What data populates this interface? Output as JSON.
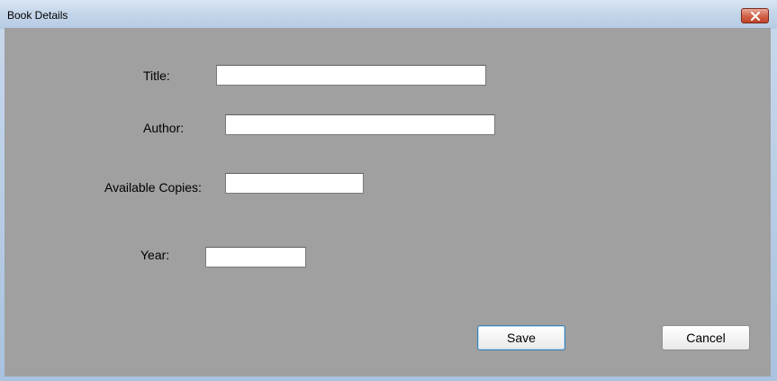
{
  "window": {
    "title": "Book Details",
    "close_icon": "close-icon"
  },
  "form": {
    "title_label": "Title:",
    "title_value": "",
    "author_label": "Author:",
    "author_value": "",
    "copies_label": "Available Copies:",
    "copies_value": "",
    "year_label": "Year:",
    "year_value": ""
  },
  "buttons": {
    "save_label": "Save",
    "cancel_label": "Cancel"
  },
  "colors": {
    "client_background": "#a0a0a0",
    "close_button": "#c0442a",
    "default_button_border": "#3c7fb1"
  }
}
